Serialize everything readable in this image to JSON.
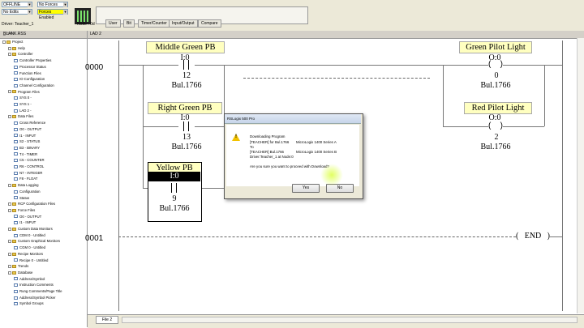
{
  "toolbar": {
    "mode": "OFFLINE",
    "forces": "No Forces",
    "edits": "No Edits",
    "forces_state": "Forces Enabled",
    "driver": "Driver: Teacher_1",
    "node": "Node : 0d",
    "tabs": [
      "User",
      "Bit",
      "Timer/Counter",
      "Input/Output",
      "Compare"
    ]
  },
  "tree": {
    "title": "BLANK.RSS",
    "items": [
      {
        "label": "Project",
        "indent": 0,
        "icon": "folder-icon"
      },
      {
        "label": "Help",
        "indent": 1,
        "icon": "folder-icon"
      },
      {
        "label": "Controller",
        "indent": 1,
        "icon": "folder-icon"
      },
      {
        "label": "Controller Properties",
        "indent": 2,
        "icon": "file-icon"
      },
      {
        "label": "Processor Status",
        "indent": 2,
        "icon": "file-icon"
      },
      {
        "label": "Function Files",
        "indent": 2,
        "icon": "file-icon"
      },
      {
        "label": "IO Configuration",
        "indent": 2,
        "icon": "file-icon"
      },
      {
        "label": "Channel Configuration",
        "indent": 2,
        "icon": "file-icon"
      },
      {
        "label": "Program Files",
        "indent": 1,
        "icon": "folder-icon"
      },
      {
        "label": "SYS 0 -",
        "indent": 2,
        "icon": "file-icon"
      },
      {
        "label": "SYS 1 -",
        "indent": 2,
        "icon": "file-icon"
      },
      {
        "label": "LAD 2 -",
        "indent": 2,
        "icon": "file-icon"
      },
      {
        "label": "Data Files",
        "indent": 1,
        "icon": "folder-icon"
      },
      {
        "label": "Cross Reference",
        "indent": 2,
        "icon": "file-icon"
      },
      {
        "label": "O0 - OUTPUT",
        "indent": 2,
        "icon": "file-icon"
      },
      {
        "label": "I1 - INPUT",
        "indent": 2,
        "icon": "file-icon"
      },
      {
        "label": "S2 - STATUS",
        "indent": 2,
        "icon": "file-icon"
      },
      {
        "label": "B3 - BINARY",
        "indent": 2,
        "icon": "file-icon"
      },
      {
        "label": "T4 - TIMER",
        "indent": 2,
        "icon": "file-icon"
      },
      {
        "label": "C5 - COUNTER",
        "indent": 2,
        "icon": "file-icon"
      },
      {
        "label": "R6 - CONTROL",
        "indent": 2,
        "icon": "file-icon"
      },
      {
        "label": "N7 - INTEGER",
        "indent": 2,
        "icon": "file-icon"
      },
      {
        "label": "F8 - FLOAT",
        "indent": 2,
        "icon": "file-icon"
      },
      {
        "label": "Data Logging",
        "indent": 1,
        "icon": "folder-icon"
      },
      {
        "label": "Configuration",
        "indent": 2,
        "icon": "file-icon"
      },
      {
        "label": "Status",
        "indent": 2,
        "icon": "file-icon"
      },
      {
        "label": "RCP Configuration Files",
        "indent": 1,
        "icon": "folder-icon"
      },
      {
        "label": "Force Files",
        "indent": 1,
        "icon": "folder-icon"
      },
      {
        "label": "O0 - OUTPUT",
        "indent": 2,
        "icon": "file-icon"
      },
      {
        "label": "I1 - INPUT",
        "indent": 2,
        "icon": "file-icon"
      },
      {
        "label": "Custom Data Monitors",
        "indent": 1,
        "icon": "folder-icon"
      },
      {
        "label": "CDM 0 - Untitled",
        "indent": 2,
        "icon": "file-icon"
      },
      {
        "label": "Custom Graphical Monitors",
        "indent": 1,
        "icon": "folder-icon"
      },
      {
        "label": "CGM 0 - Untitled",
        "indent": 2,
        "icon": "file-icon"
      },
      {
        "label": "Recipe Monitors",
        "indent": 1,
        "icon": "folder-icon"
      },
      {
        "label": "Recipe 0 - Untitled",
        "indent": 2,
        "icon": "file-icon"
      },
      {
        "label": "Trends",
        "indent": 1,
        "icon": "folder-icon"
      },
      {
        "label": "Database",
        "indent": 1,
        "icon": "folder-icon"
      },
      {
        "label": "Address/Symbol",
        "indent": 2,
        "icon": "file-icon"
      },
      {
        "label": "Instruction Comments",
        "indent": 2,
        "icon": "file-icon"
      },
      {
        "label": "Rung Comments/Page Title",
        "indent": 2,
        "icon": "file-icon"
      },
      {
        "label": "Address/Symbol Picker",
        "indent": 2,
        "icon": "file-icon"
      },
      {
        "label": "Symbol Groups",
        "indent": 2,
        "icon": "file-icon"
      }
    ]
  },
  "ladder": {
    "title": "LAD 2",
    "rung0": "0000",
    "rung1": "0001",
    "end": "END",
    "middle_green": {
      "label": "Middle Green PB",
      "addr": "I:0",
      "bit": "12",
      "part": "Bul.1766"
    },
    "right_green": {
      "label": "Right Green PB",
      "addr": "I:0",
      "bit": "13",
      "part": "Bul.1766"
    },
    "yellow": {
      "label": "Yellow PB",
      "addr": "I:0",
      "bit": "9",
      "part": "Bul.1766"
    },
    "green_pilot": {
      "label": "Green Pilot Light",
      "addr": "O:0",
      "bit": "0",
      "part": "Bul.1766"
    },
    "red_pilot": {
      "label": "Red Pilot Light",
      "addr": "O:0",
      "bit": "2",
      "part": "Bul.1766"
    }
  },
  "dialog": {
    "title": "RSLogix 500 Pro",
    "line1": "Downloading Program",
    "line2a": "[TEACHER] for Bul.1766",
    "line2b": "MicroLogix 1400 Series A",
    "line3": "To",
    "line4a": "[TEACHER] Bul.1766",
    "line4b": "MicroLogix 1400 Series B",
    "line5": "Driver:Teacher_1 at Node:0",
    "question": "Are you sure you want to proceed with Download?",
    "yes": "Yes",
    "no": "No"
  },
  "bottom": {
    "file_tab": "File 2"
  }
}
